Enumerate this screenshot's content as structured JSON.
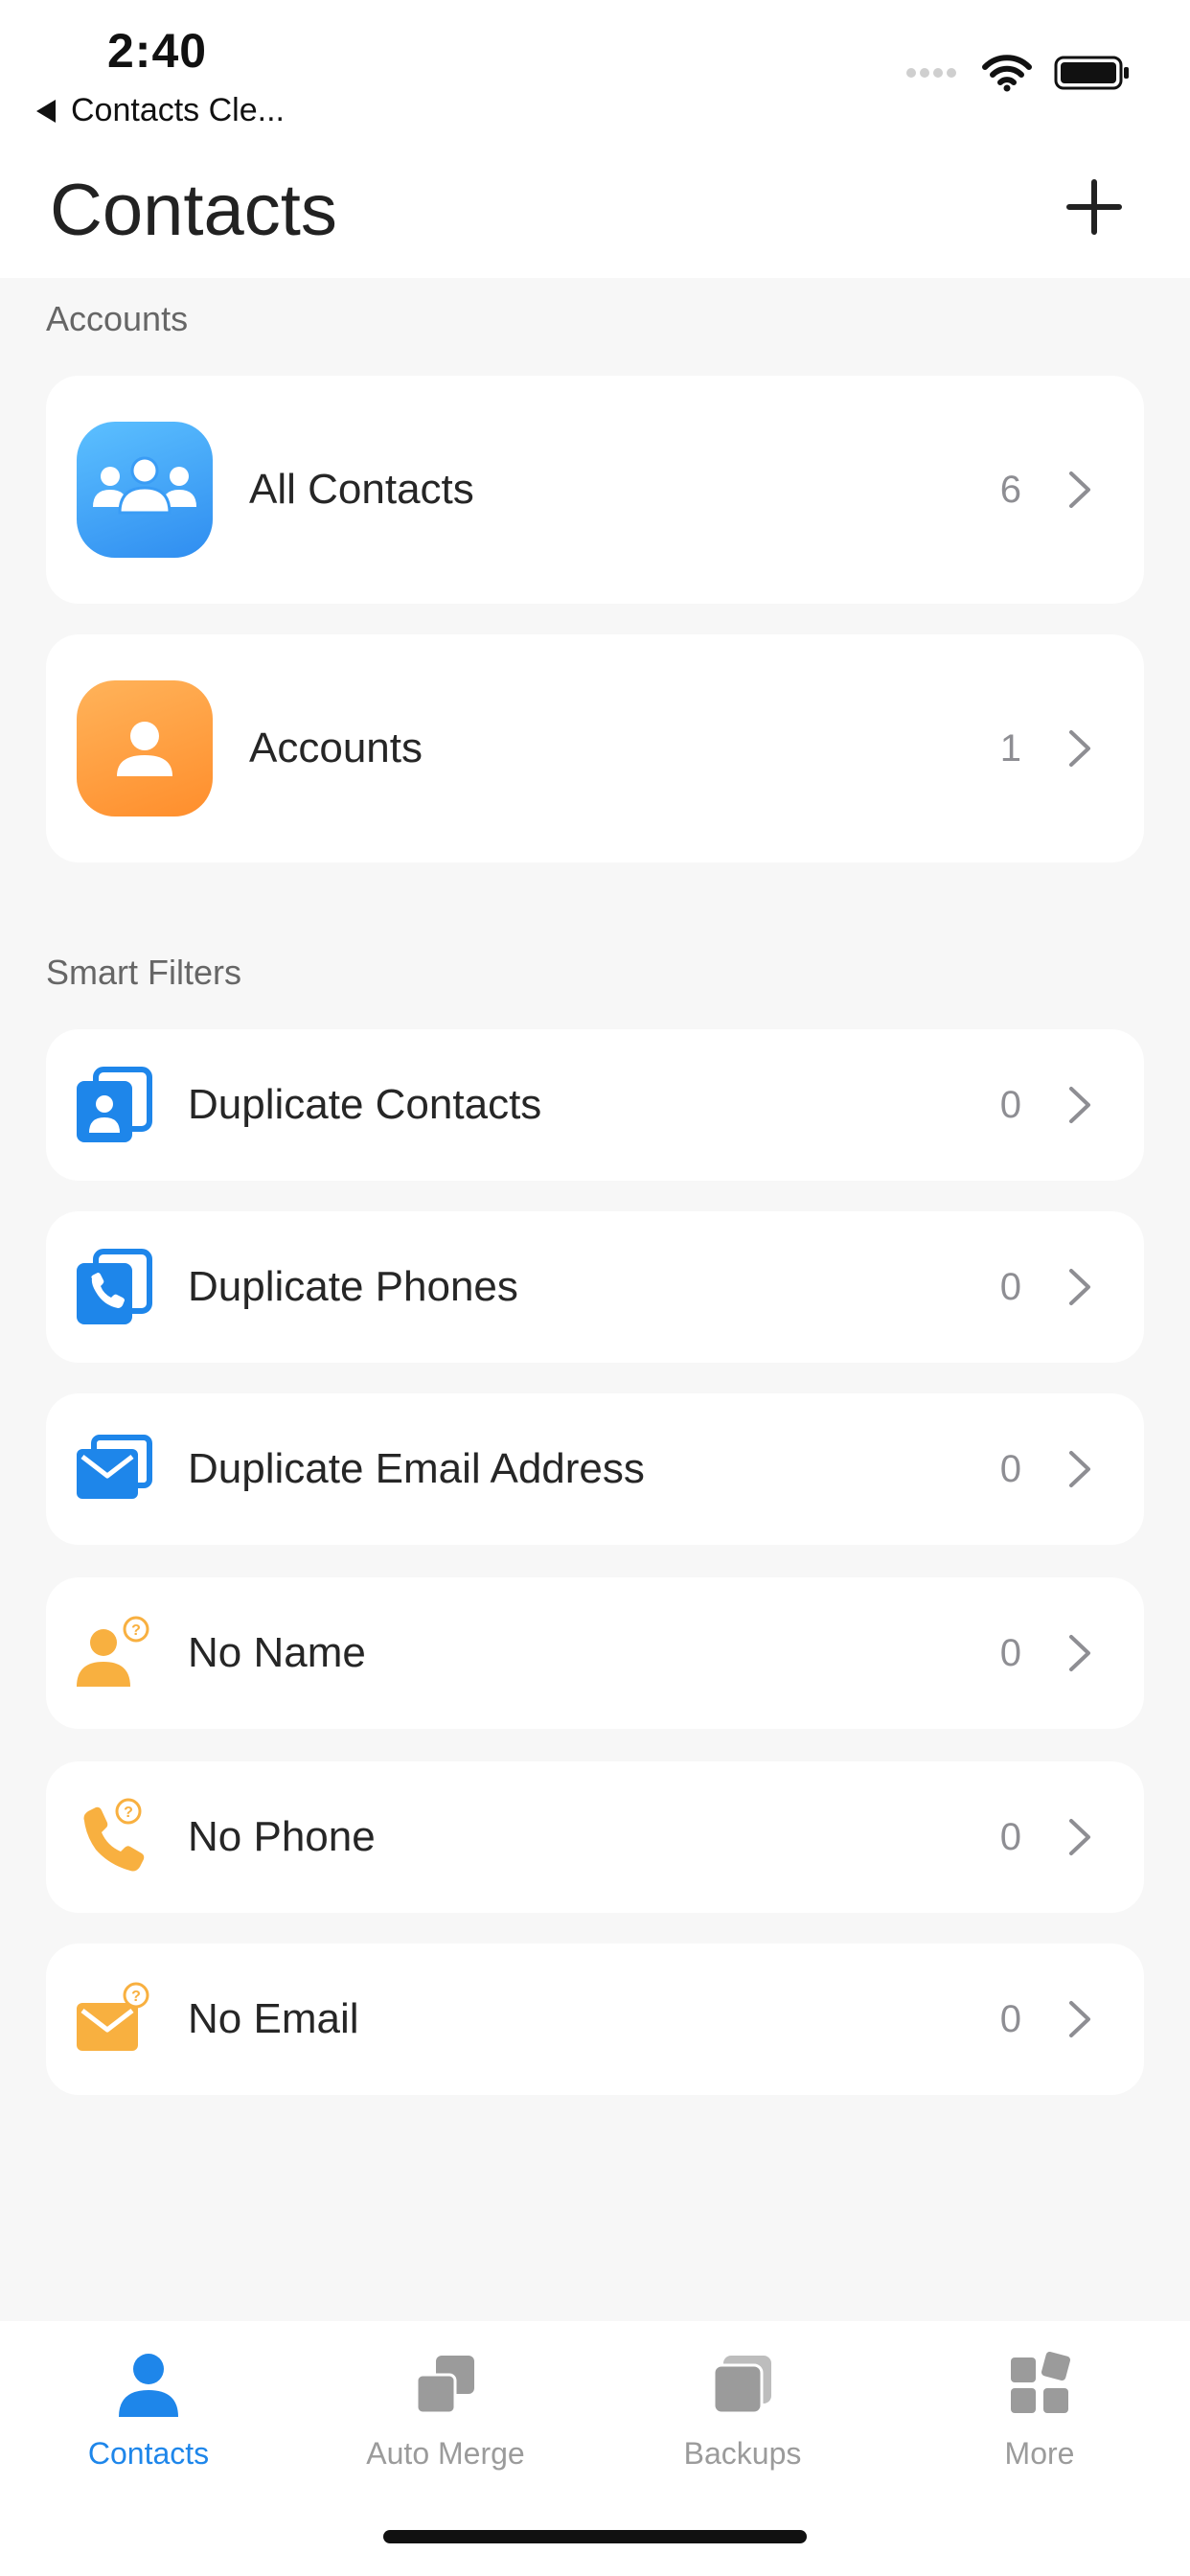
{
  "status_bar": {
    "time": "2:40",
    "back_label": "Contacts Cle..."
  },
  "header": {
    "title": "Contacts"
  },
  "sections": {
    "accounts_label": "Accounts",
    "smart_filters_label": "Smart Filters"
  },
  "accounts": [
    {
      "label": "All Contacts",
      "count": "6",
      "icon": "group-icon"
    },
    {
      "label": "Accounts",
      "count": "1",
      "icon": "person-icon"
    }
  ],
  "filters": [
    {
      "label": "Duplicate Contacts",
      "count": "0",
      "icon": "duplicate-contacts-icon"
    },
    {
      "label": "Duplicate Phones",
      "count": "0",
      "icon": "duplicate-phones-icon"
    },
    {
      "label": "Duplicate Email Address",
      "count": "0",
      "icon": "duplicate-email-icon"
    },
    {
      "label": "No Name",
      "count": "0",
      "icon": "no-name-icon"
    },
    {
      "label": "No Phone",
      "count": "0",
      "icon": "no-phone-icon"
    },
    {
      "label": "No Email",
      "count": "0",
      "icon": "no-email-icon"
    }
  ],
  "tabs": [
    {
      "label": "Contacts",
      "active": true
    },
    {
      "label": "Auto Merge",
      "active": false
    },
    {
      "label": "Backups",
      "active": false
    },
    {
      "label": "More",
      "active": false
    }
  ],
  "colors": {
    "accent_blue": "#1e86ea",
    "orange": "#ffa53d",
    "yellow_orange": "#f8b040",
    "inactive_gray": "#9b9b9b"
  }
}
